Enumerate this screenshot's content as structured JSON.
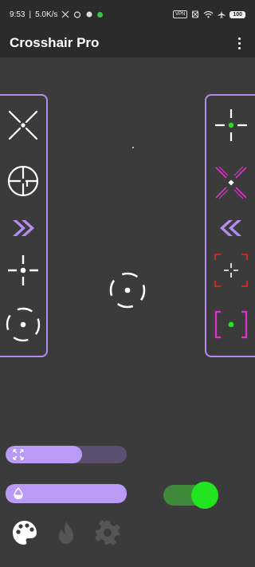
{
  "status_bar": {
    "time": "9:53",
    "speed": "5.0K/s",
    "battery": "100",
    "vpn": "VPN"
  },
  "app": {
    "title": "Crosshair Pro"
  },
  "left_panel": {
    "items": [
      "x-cross-icon",
      "sniper-scope-icon",
      "expand-chevrons-icon",
      "plus-gap-dot-icon",
      "circle-dot-icon"
    ]
  },
  "right_panel": {
    "items": [
      "plus-green-dot-icon",
      "magenta-x-icon",
      "collapse-chevrons-icon",
      "red-bracket-cross-icon",
      "magenta-bracket-green-dot-icon"
    ]
  },
  "controls": {
    "size_slider": {
      "icon": "expand-arrows-icon",
      "level_percent": 63
    },
    "opacity_slider": {
      "icon": "opacity-drop-icon",
      "level_percent": 100
    },
    "toggle": {
      "state": "on",
      "color": "#22e51f"
    }
  },
  "colors": {
    "accent_purple": "#b48cf0",
    "app_bar": "#2b2b2b",
    "background": "#3b3b3b",
    "magenta": "#e030d0",
    "green": "#22e51f",
    "red": "#d42a2a"
  },
  "bottom_bar": [
    "palette-icon",
    "flame-icon",
    "gear-icon"
  ]
}
